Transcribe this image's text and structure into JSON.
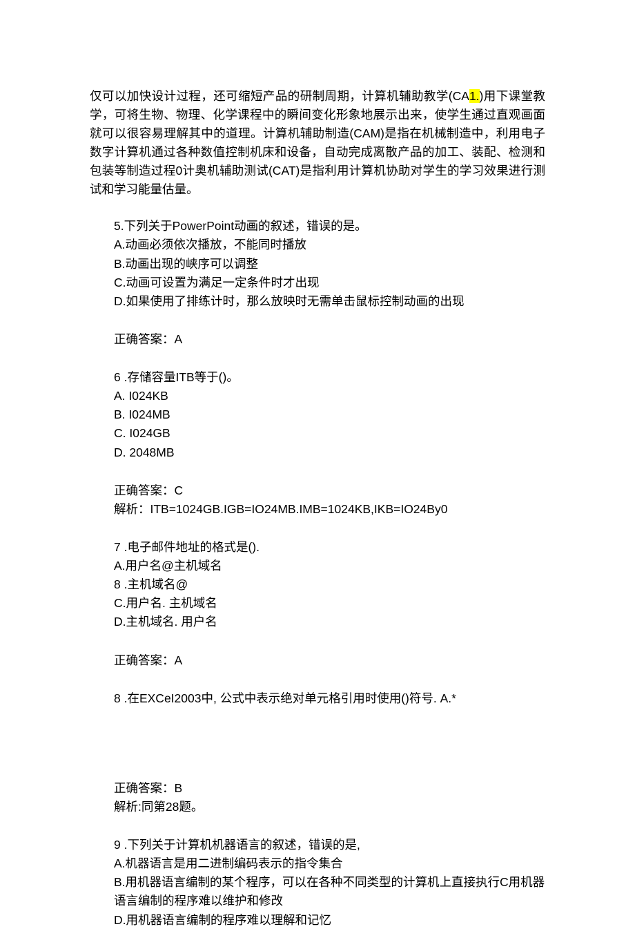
{
  "intro": {
    "t1a": "仅可以加快设计过程，还可缩短产品的研制周期，计算机辅助教学(CA",
    "hl": "1.",
    "t1b": ")用下课堂教学，可将生物、物理、化学课程中的瞬间变化形象地展示出来，使学生通过直观画面就可以很容易理解其中的道理。计算机辅助制造(CAM)是指在机械制造中，利用电子数字计算机通过各种数值控制机床和设备，自动完成离散产品的加工、装配、检测和包装等制造过程0计奥机辅助测试(CAT)是指利用计算机协助对学生的学习效果进行测试和学习能量估量。"
  },
  "q5": {
    "stem": "5.下列关于PowerPoint动画的叙述，错误的是。",
    "a": "A.动画必须依次播放，不能同时播放",
    "b": "B.动画出现的峡序可以调整",
    "c": "C.动画可设置为满足一定条件时才出现",
    "d": "D.如果使用了排练计时，那么放映时无需单击鼠标控制动画的出现",
    "ans": "正确答案：A"
  },
  "q6": {
    "stem": "6  .存储容量ITB等于()。",
    "a": "A.   I024KB",
    "b": "B.   I024MB",
    "c": "C.   I024GB",
    "d": "D.   2048MB",
    "ans": "正确答案：C",
    "exp": "解析：ITB=1024GB.IGB=IO24MB.IMB=1024KB,IKB=IO24By0"
  },
  "q7": {
    "stem": "7  .电子邮件地址的格式是().",
    "a": "A.用户名@主机域名",
    "b": "8  .主机域名@",
    "c": "C.用户名. 主机域名",
    "d": "D.主机域名. 用户名",
    "ans": "正确答案：A"
  },
  "q8": {
    "stem": "8  .在EXCeI2003中, 公式中表示绝对单元格引用时使用()符号. A.*",
    "ans": "正确答案：B",
    "exp": "解析:同第28题。"
  },
  "q9": {
    "stem": "9  .下列关于计算机机器语言的叙述，错误的是,",
    "a": "A.机器语言是用二进制编码表示的指令集合",
    "b": "B.用机器语言编制的某个程序，可以在各种不同类型的计算机上直接执行C用机器语言编制的程序难以维护和修改",
    "d": "D.用机器语言编制的程序难以理解和记忆"
  }
}
